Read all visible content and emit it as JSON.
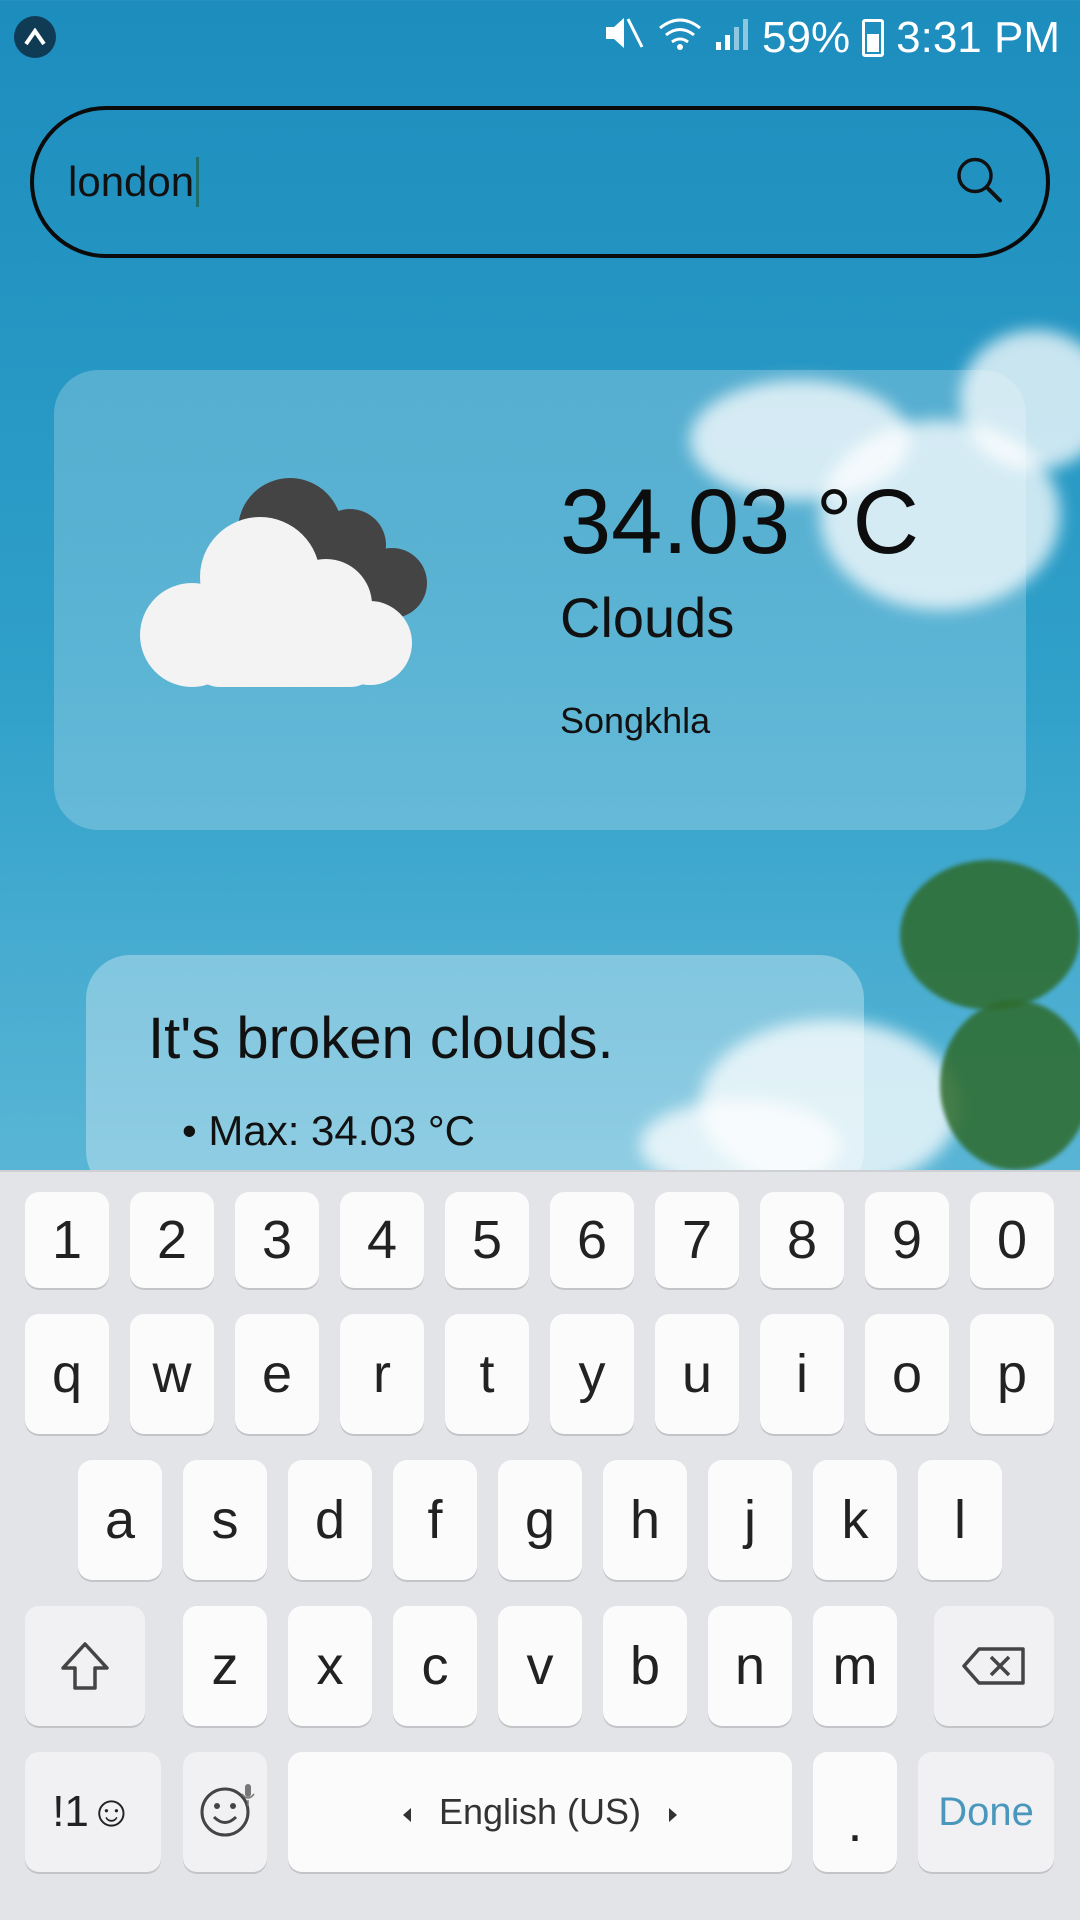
{
  "status_bar": {
    "battery_percent": "59%",
    "time": "3:31 PM"
  },
  "search": {
    "value": "london",
    "placeholder": ""
  },
  "weather": {
    "temperature": "34.03 °C",
    "condition": "Clouds",
    "city": "Songkhla",
    "icon": "cloud-icon"
  },
  "details": {
    "title": "It's broken clouds.",
    "items": [
      "Max: 34.03 °C"
    ]
  },
  "keyboard": {
    "row_numbers": [
      "1",
      "2",
      "3",
      "4",
      "5",
      "6",
      "7",
      "8",
      "9",
      "0"
    ],
    "row_top": [
      "q",
      "w",
      "e",
      "r",
      "t",
      "y",
      "u",
      "i",
      "o",
      "p"
    ],
    "row_middle": [
      "a",
      "s",
      "d",
      "f",
      "g",
      "h",
      "j",
      "k",
      "l"
    ],
    "row_bottom": [
      "z",
      "x",
      "c",
      "v",
      "b",
      "n",
      "m"
    ],
    "symbols_label": "!1☺",
    "space_label": "English (US)",
    "period_label": ".",
    "done_label": "Done"
  },
  "colors": {
    "sky": "#2fa0c9",
    "done_accent": "#4a97bd",
    "keyboard_bg": "#e3e4e8"
  }
}
